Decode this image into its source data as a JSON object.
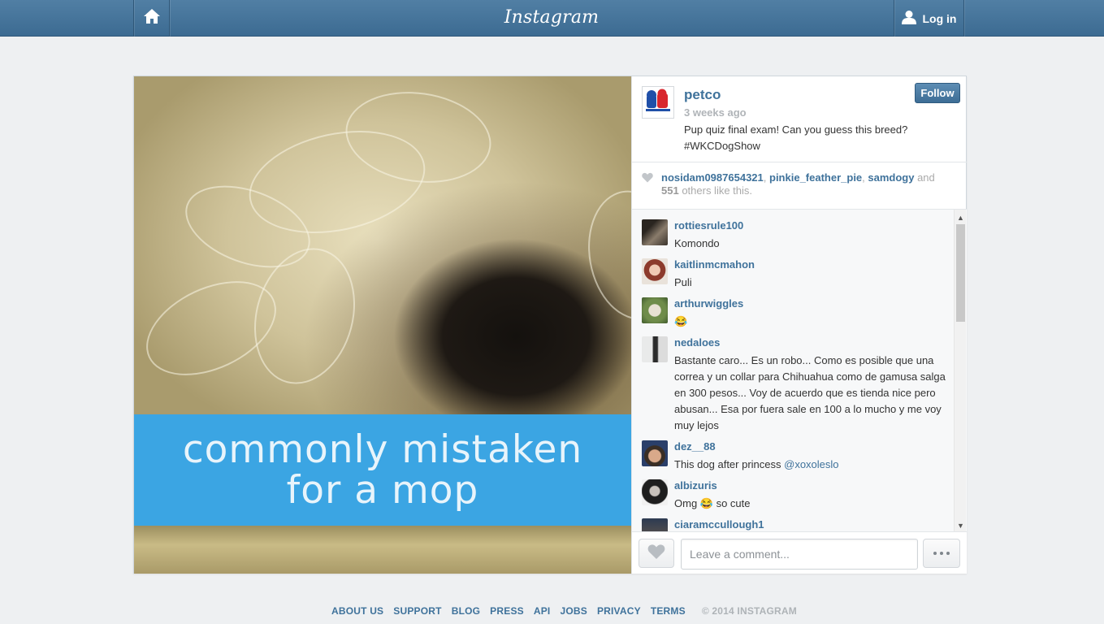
{
  "header": {
    "logo_text": "Instagram",
    "login_label": "Log in"
  },
  "photo": {
    "banner_line1": "commonly mistaken",
    "banner_line2": "for a mop",
    "banner_color": "#3ba5e3"
  },
  "post": {
    "author": "petco",
    "time": "3 weeks ago",
    "caption_line1": "Pup quiz final exam! Can you guess this breed?",
    "caption_line2": "#WKCDogShow",
    "follow_label": "Follow"
  },
  "likes": {
    "users": [
      "nosidam0987654321",
      "pinkie_feather_pie",
      "samdogy"
    ],
    "sep1": ", ",
    "sep2": ", ",
    "and_text": " and",
    "count": "551",
    "suffix": " others like this."
  },
  "comments": [
    {
      "user": "rottiesrule100",
      "text": "Komondo"
    },
    {
      "user": "kaitlinmcmahon",
      "text": "Puli"
    },
    {
      "user": "arthurwiggles",
      "text": "😂"
    },
    {
      "user": "nedaloes",
      "text": "Bastante caro... Es un robo... Como es posible que una correa y un collar para Chihuahua como de gamusa salga en 300 pesos... Voy de acuerdo que es tienda nice pero abusan... Esa por fuera sale en 100 a lo mucho y me voy muy lejos"
    },
    {
      "user": "dez__88",
      "text": "This dog after princess ",
      "mention": "@xoxoleslo"
    },
    {
      "user": "albizuris",
      "text": "Omg 😂 so cute"
    },
    {
      "user": "ciaramccullough1",
      "text": ""
    }
  ],
  "compose": {
    "placeholder": "Leave a comment..."
  },
  "footer": {
    "links": [
      "ABOUT US",
      "SUPPORT",
      "BLOG",
      "PRESS",
      "API",
      "JOBS",
      "PRIVACY",
      "TERMS"
    ],
    "copyright": "© 2014 INSTAGRAM"
  },
  "colors": {
    "header": "#3f6f96",
    "link": "#3f729b",
    "follow": "#4a7aa3"
  }
}
